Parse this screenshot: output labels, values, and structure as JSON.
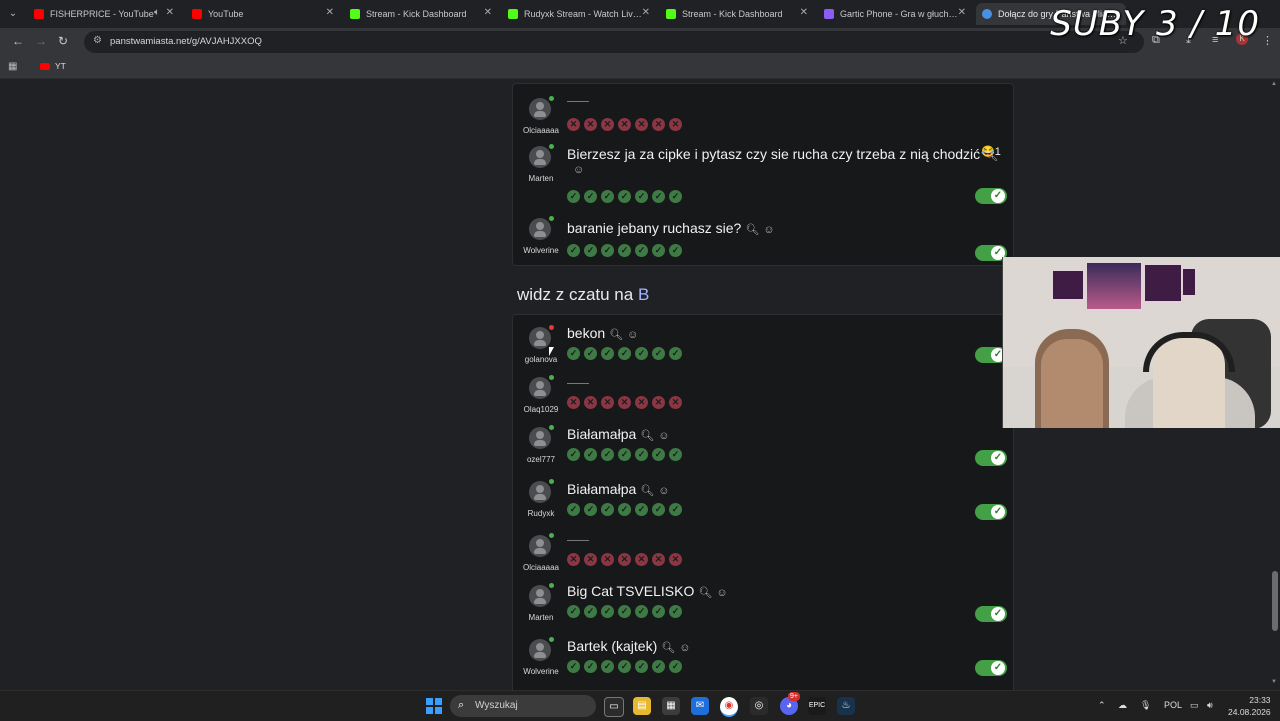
{
  "browser": {
    "tabs": [
      {
        "label": "FISHERPRICE - YouTube",
        "color": "#ff0000"
      },
      {
        "label": "YouTube",
        "color": "#ff0000"
      },
      {
        "label": "Stream - Kick Dashboard",
        "color": "#53fc18"
      },
      {
        "label": "Rudyxk Stream - Watch Live on",
        "color": "#53fc18"
      },
      {
        "label": "Stream - Kick Dashboard",
        "color": "#53fc18"
      },
      {
        "label": "Gartic Phone - Gra w głuchy tel",
        "color": "#8b5cf6"
      },
      {
        "label": "Dołącz do gry Państwa Miasta",
        "color": "#4a90e2"
      }
    ],
    "url": "panstwamiasta.net/g/AVJAHJXXOQ",
    "bookmark": "YT",
    "overlay_text": "SUBY 3 / 10"
  },
  "top_card": {
    "rows": [
      {
        "user": "Olciaaaaa",
        "answer": "",
        "status": "green",
        "votes": [
          "no",
          "no",
          "no",
          "no",
          "no",
          "no",
          "no"
        ],
        "accepted": false
      },
      {
        "user": "Marten",
        "answer": "Bierzesz ja za cipke i pytasz czy sie rucha czy trzeba z nią chodzić",
        "reaction": "😂1",
        "status": "green",
        "votes": [
          "ok",
          "ok",
          "ok",
          "ok",
          "ok",
          "ok",
          "ok"
        ],
        "accepted": true
      },
      {
        "user": "Wolverine",
        "answer": "baranie jebany ruchasz sie?",
        "status": "green",
        "votes": [
          "ok",
          "ok",
          "ok",
          "ok",
          "ok",
          "ok",
          "ok"
        ],
        "accepted": true
      }
    ]
  },
  "section": {
    "title_prefix": "widz z czatu na ",
    "letter": "B"
  },
  "bottom_card": {
    "rows": [
      {
        "user": "golanova",
        "answer": "bekon",
        "status": "red",
        "votes": [
          "ok",
          "ok",
          "ok",
          "ok",
          "ok",
          "ok",
          "ok"
        ],
        "accepted": true
      },
      {
        "user": "Olaq1029",
        "answer": "",
        "status": "green",
        "votes": [
          "no",
          "no",
          "no",
          "no",
          "no",
          "no",
          "no"
        ],
        "accepted": false
      },
      {
        "user": "ozel777",
        "answer": "Białamałpa",
        "status": "green",
        "votes": [
          "ok",
          "ok",
          "ok",
          "ok",
          "ok",
          "ok",
          "ok"
        ],
        "accepted": true
      },
      {
        "user": "Rudyxk",
        "answer": "Białamałpa",
        "status": "green",
        "votes": [
          "ok",
          "ok",
          "ok",
          "ok",
          "ok",
          "ok",
          "ok"
        ],
        "accepted": true
      },
      {
        "user": "Olciaaaaa",
        "answer": "",
        "status": "green",
        "votes": [
          "no",
          "no",
          "no",
          "no",
          "no",
          "no",
          "no"
        ],
        "accepted": false
      },
      {
        "user": "Marten",
        "answer": "Big Cat TSVELISKO",
        "status": "green",
        "votes": [
          "ok",
          "ok",
          "ok",
          "ok",
          "ok",
          "ok",
          "ok"
        ],
        "accepted": true
      },
      {
        "user": "Wolverine",
        "answer": "Bartek (kajtek)",
        "status": "green",
        "votes": [
          "ok",
          "ok",
          "ok",
          "ok",
          "ok",
          "ok",
          "ok"
        ],
        "accepted": true
      }
    ]
  },
  "taskbar": {
    "search": "Wyszukaj",
    "lang": "POL",
    "time": "23:33",
    "date": "24.08.2026",
    "badge": "9+"
  },
  "icons": {
    "search": "search-icon",
    "react": "emoji-add-icon"
  }
}
